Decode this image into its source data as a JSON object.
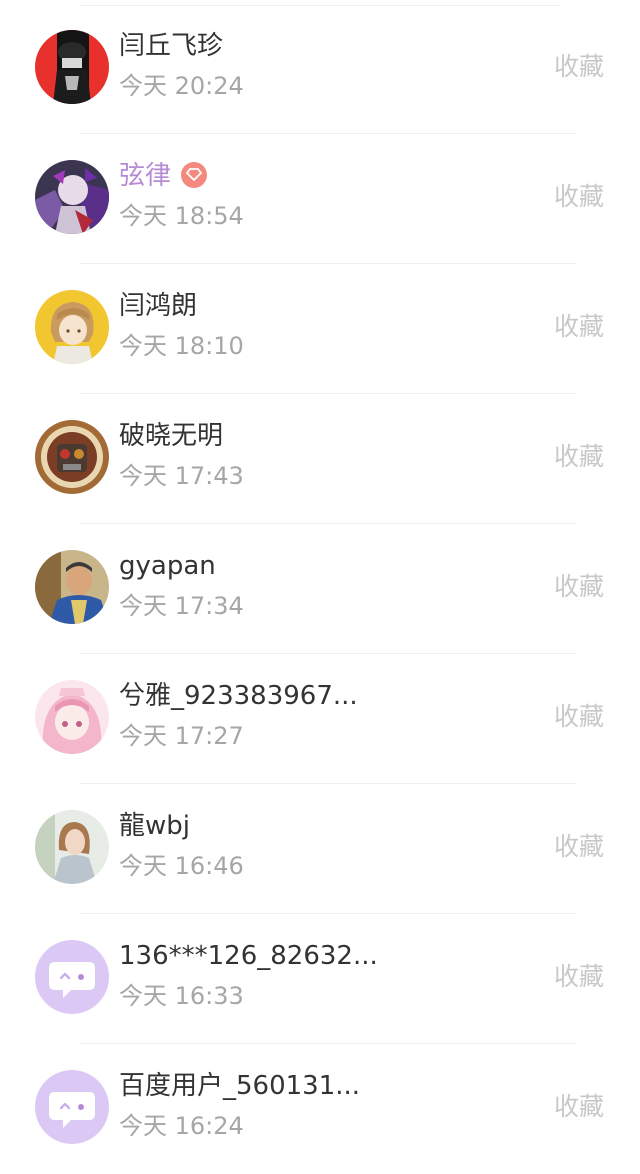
{
  "rows": [
    {
      "name": "闫丘飞珍",
      "time": "今天 20:24",
      "action": "收藏",
      "vip": false,
      "avatar": "dark-character-avatar"
    },
    {
      "name": "弦律",
      "time": "今天 18:54",
      "action": "收藏",
      "vip": true,
      "avatar": "anime-character-avatar"
    },
    {
      "name": "闫鸿朗",
      "time": "今天 18:10",
      "action": "收藏",
      "vip": false,
      "avatar": "cartoon-girl-avatar"
    },
    {
      "name": "破晓无明",
      "time": "今天 17:43",
      "action": "收藏",
      "vip": false,
      "avatar": "game-emblem-avatar"
    },
    {
      "name": "gyapan",
      "time": "今天 17:34",
      "action": "收藏",
      "vip": false,
      "avatar": "man-photo-avatar"
    },
    {
      "name": "兮雅_923383967...",
      "time": "今天 17:27",
      "action": "收藏",
      "vip": false,
      "avatar": "pink-anime-avatar"
    },
    {
      "name": "龍wbj",
      "time": "今天 16:46",
      "action": "收藏",
      "vip": false,
      "avatar": "woman-photo-avatar"
    },
    {
      "name": "136***126_82632...",
      "time": "今天 16:33",
      "action": "收藏",
      "vip": false,
      "avatar": "default-chat-avatar"
    },
    {
      "name": "百度用户_560131...",
      "time": "今天 16:24",
      "action": "收藏",
      "vip": false,
      "avatar": "default-chat-avatar"
    }
  ],
  "colors": {
    "name": "#333333",
    "vip_name": "#b58bd6",
    "time": "#a6a6a6",
    "action": "#c8c8c8",
    "default_avatar": "#dcc8f5",
    "vip_badge": "#f4897f"
  }
}
